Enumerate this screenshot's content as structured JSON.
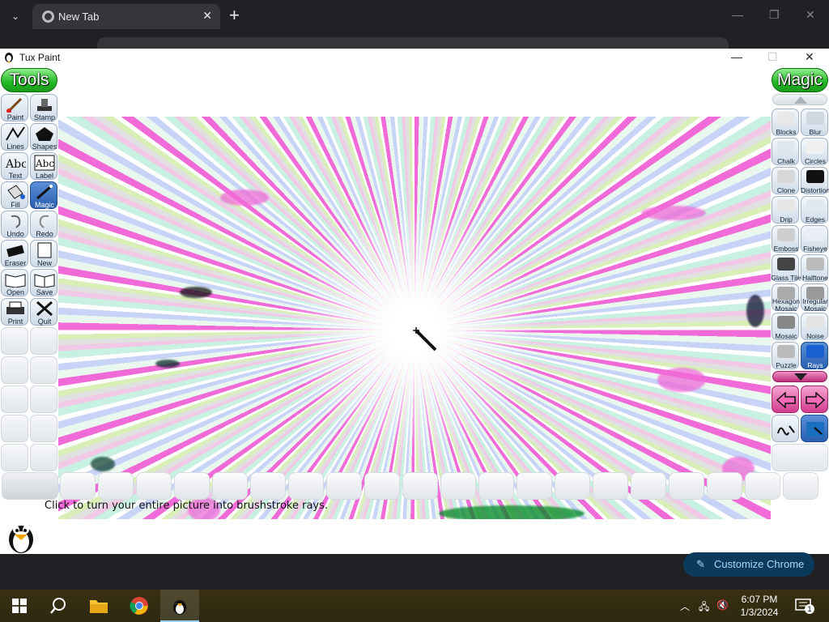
{
  "browser": {
    "tab_title": "New Tab",
    "customize_label": "Customize Chrome"
  },
  "app": {
    "title": "Tux Paint",
    "tools_header": "Tools",
    "magic_header": "Magic",
    "status_message": "Click to turn your entire picture into brushstroke rays."
  },
  "tools": [
    {
      "label": "Paint",
      "icon": "paintbrush-icon"
    },
    {
      "label": "Stamp",
      "icon": "stamp-icon"
    },
    {
      "label": "Lines",
      "icon": "lines-icon"
    },
    {
      "label": "Shapes",
      "icon": "shapes-icon"
    },
    {
      "label": "Text",
      "icon": "text-icon"
    },
    {
      "label": "Label",
      "icon": "label-icon"
    },
    {
      "label": "Fill",
      "icon": "fill-bucket-icon"
    },
    {
      "label": "Magic",
      "icon": "magic-wand-icon",
      "selected": true
    },
    {
      "label": "Undo",
      "icon": "undo-icon"
    },
    {
      "label": "Redo",
      "icon": "redo-icon"
    },
    {
      "label": "Eraser",
      "icon": "eraser-icon"
    },
    {
      "label": "New",
      "icon": "new-page-icon"
    },
    {
      "label": "Open",
      "icon": "open-book-icon"
    },
    {
      "label": "Save",
      "icon": "save-book-icon"
    },
    {
      "label": "Print",
      "icon": "printer-icon"
    },
    {
      "label": "Quit",
      "icon": "quit-x-icon"
    }
  ],
  "magic_tools": [
    {
      "label": "Blocks"
    },
    {
      "label": "Blur"
    },
    {
      "label": "Chalk"
    },
    {
      "label": "Circles"
    },
    {
      "label": "Clone"
    },
    {
      "label": "Distortion"
    },
    {
      "label": "Drip"
    },
    {
      "label": "Edges"
    },
    {
      "label": "Emboss"
    },
    {
      "label": "Fisheye"
    },
    {
      "label": "Glass Tile"
    },
    {
      "label": "Halftone"
    },
    {
      "label": "Hexagon Mosaic"
    },
    {
      "label": "Irregular Mosaic"
    },
    {
      "label": "Mosaic"
    },
    {
      "label": "Noise"
    },
    {
      "label": "Puzzle"
    },
    {
      "label": "Rays",
      "selected": true
    }
  ],
  "taskbar": {
    "time": "6:07 PM",
    "date": "1/3/2024",
    "notification_count": "1"
  },
  "colors": {
    "accent_green": "#22b822",
    "selected_blue": "#2a5fb0",
    "magenta": "#f06ad8"
  }
}
